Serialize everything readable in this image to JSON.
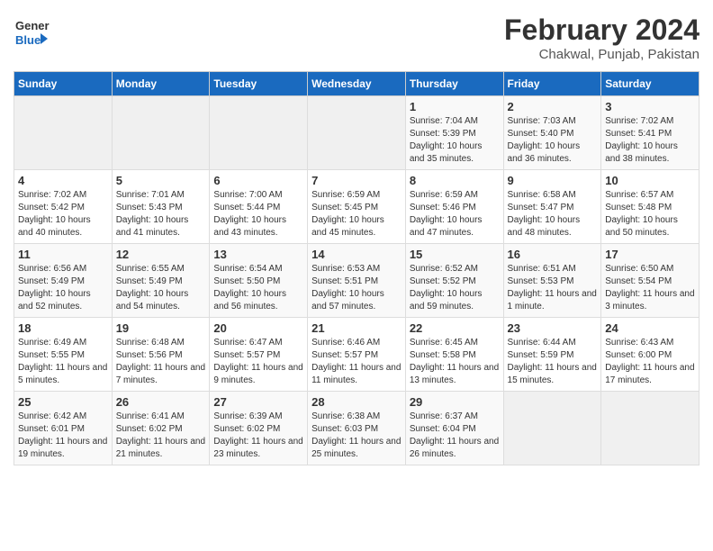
{
  "logo": {
    "text_general": "General",
    "text_blue": "Blue"
  },
  "title": "February 2024",
  "subtitle": "Chakwal, Punjab, Pakistan",
  "days_of_week": [
    "Sunday",
    "Monday",
    "Tuesday",
    "Wednesday",
    "Thursday",
    "Friday",
    "Saturday"
  ],
  "weeks": [
    [
      {
        "day": "",
        "sunrise": "",
        "sunset": "",
        "daylight": "",
        "empty": true
      },
      {
        "day": "",
        "sunrise": "",
        "sunset": "",
        "daylight": "",
        "empty": true
      },
      {
        "day": "",
        "sunrise": "",
        "sunset": "",
        "daylight": "",
        "empty": true
      },
      {
        "day": "",
        "sunrise": "",
        "sunset": "",
        "daylight": "",
        "empty": true
      },
      {
        "day": "1",
        "sunrise": "Sunrise: 7:04 AM",
        "sunset": "Sunset: 5:39 PM",
        "daylight": "Daylight: 10 hours and 35 minutes.",
        "empty": false
      },
      {
        "day": "2",
        "sunrise": "Sunrise: 7:03 AM",
        "sunset": "Sunset: 5:40 PM",
        "daylight": "Daylight: 10 hours and 36 minutes.",
        "empty": false
      },
      {
        "day": "3",
        "sunrise": "Sunrise: 7:02 AM",
        "sunset": "Sunset: 5:41 PM",
        "daylight": "Daylight: 10 hours and 38 minutes.",
        "empty": false
      }
    ],
    [
      {
        "day": "4",
        "sunrise": "Sunrise: 7:02 AM",
        "sunset": "Sunset: 5:42 PM",
        "daylight": "Daylight: 10 hours and 40 minutes.",
        "empty": false
      },
      {
        "day": "5",
        "sunrise": "Sunrise: 7:01 AM",
        "sunset": "Sunset: 5:43 PM",
        "daylight": "Daylight: 10 hours and 41 minutes.",
        "empty": false
      },
      {
        "day": "6",
        "sunrise": "Sunrise: 7:00 AM",
        "sunset": "Sunset: 5:44 PM",
        "daylight": "Daylight: 10 hours and 43 minutes.",
        "empty": false
      },
      {
        "day": "7",
        "sunrise": "Sunrise: 6:59 AM",
        "sunset": "Sunset: 5:45 PM",
        "daylight": "Daylight: 10 hours and 45 minutes.",
        "empty": false
      },
      {
        "day": "8",
        "sunrise": "Sunrise: 6:59 AM",
        "sunset": "Sunset: 5:46 PM",
        "daylight": "Daylight: 10 hours and 47 minutes.",
        "empty": false
      },
      {
        "day": "9",
        "sunrise": "Sunrise: 6:58 AM",
        "sunset": "Sunset: 5:47 PM",
        "daylight": "Daylight: 10 hours and 48 minutes.",
        "empty": false
      },
      {
        "day": "10",
        "sunrise": "Sunrise: 6:57 AM",
        "sunset": "Sunset: 5:48 PM",
        "daylight": "Daylight: 10 hours and 50 minutes.",
        "empty": false
      }
    ],
    [
      {
        "day": "11",
        "sunrise": "Sunrise: 6:56 AM",
        "sunset": "Sunset: 5:49 PM",
        "daylight": "Daylight: 10 hours and 52 minutes.",
        "empty": false
      },
      {
        "day": "12",
        "sunrise": "Sunrise: 6:55 AM",
        "sunset": "Sunset: 5:49 PM",
        "daylight": "Daylight: 10 hours and 54 minutes.",
        "empty": false
      },
      {
        "day": "13",
        "sunrise": "Sunrise: 6:54 AM",
        "sunset": "Sunset: 5:50 PM",
        "daylight": "Daylight: 10 hours and 56 minutes.",
        "empty": false
      },
      {
        "day": "14",
        "sunrise": "Sunrise: 6:53 AM",
        "sunset": "Sunset: 5:51 PM",
        "daylight": "Daylight: 10 hours and 57 minutes.",
        "empty": false
      },
      {
        "day": "15",
        "sunrise": "Sunrise: 6:52 AM",
        "sunset": "Sunset: 5:52 PM",
        "daylight": "Daylight: 10 hours and 59 minutes.",
        "empty": false
      },
      {
        "day": "16",
        "sunrise": "Sunrise: 6:51 AM",
        "sunset": "Sunset: 5:53 PM",
        "daylight": "Daylight: 11 hours and 1 minute.",
        "empty": false
      },
      {
        "day": "17",
        "sunrise": "Sunrise: 6:50 AM",
        "sunset": "Sunset: 5:54 PM",
        "daylight": "Daylight: 11 hours and 3 minutes.",
        "empty": false
      }
    ],
    [
      {
        "day": "18",
        "sunrise": "Sunrise: 6:49 AM",
        "sunset": "Sunset: 5:55 PM",
        "daylight": "Daylight: 11 hours and 5 minutes.",
        "empty": false
      },
      {
        "day": "19",
        "sunrise": "Sunrise: 6:48 AM",
        "sunset": "Sunset: 5:56 PM",
        "daylight": "Daylight: 11 hours and 7 minutes.",
        "empty": false
      },
      {
        "day": "20",
        "sunrise": "Sunrise: 6:47 AM",
        "sunset": "Sunset: 5:57 PM",
        "daylight": "Daylight: 11 hours and 9 minutes.",
        "empty": false
      },
      {
        "day": "21",
        "sunrise": "Sunrise: 6:46 AM",
        "sunset": "Sunset: 5:57 PM",
        "daylight": "Daylight: 11 hours and 11 minutes.",
        "empty": false
      },
      {
        "day": "22",
        "sunrise": "Sunrise: 6:45 AM",
        "sunset": "Sunset: 5:58 PM",
        "daylight": "Daylight: 11 hours and 13 minutes.",
        "empty": false
      },
      {
        "day": "23",
        "sunrise": "Sunrise: 6:44 AM",
        "sunset": "Sunset: 5:59 PM",
        "daylight": "Daylight: 11 hours and 15 minutes.",
        "empty": false
      },
      {
        "day": "24",
        "sunrise": "Sunrise: 6:43 AM",
        "sunset": "Sunset: 6:00 PM",
        "daylight": "Daylight: 11 hours and 17 minutes.",
        "empty": false
      }
    ],
    [
      {
        "day": "25",
        "sunrise": "Sunrise: 6:42 AM",
        "sunset": "Sunset: 6:01 PM",
        "daylight": "Daylight: 11 hours and 19 minutes.",
        "empty": false
      },
      {
        "day": "26",
        "sunrise": "Sunrise: 6:41 AM",
        "sunset": "Sunset: 6:02 PM",
        "daylight": "Daylight: 11 hours and 21 minutes.",
        "empty": false
      },
      {
        "day": "27",
        "sunrise": "Sunrise: 6:39 AM",
        "sunset": "Sunset: 6:02 PM",
        "daylight": "Daylight: 11 hours and 23 minutes.",
        "empty": false
      },
      {
        "day": "28",
        "sunrise": "Sunrise: 6:38 AM",
        "sunset": "Sunset: 6:03 PM",
        "daylight": "Daylight: 11 hours and 25 minutes.",
        "empty": false
      },
      {
        "day": "29",
        "sunrise": "Sunrise: 6:37 AM",
        "sunset": "Sunset: 6:04 PM",
        "daylight": "Daylight: 11 hours and 26 minutes.",
        "empty": false
      },
      {
        "day": "",
        "sunrise": "",
        "sunset": "",
        "daylight": "",
        "empty": true
      },
      {
        "day": "",
        "sunrise": "",
        "sunset": "",
        "daylight": "",
        "empty": true
      }
    ]
  ]
}
